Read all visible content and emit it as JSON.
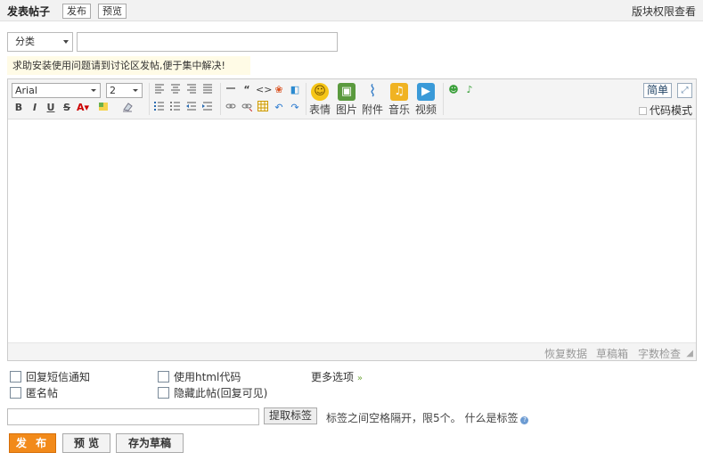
{
  "header": {
    "title": "发表帖子",
    "publish_tab": "发布",
    "preview_tab": "预览",
    "permission_link": "版块权限查看"
  },
  "form": {
    "category_value": "分类",
    "title_value": "",
    "notice": "求助安装使用问题请到讨论区发帖,便于集中解决!"
  },
  "toolbar": {
    "font_family": "Arial",
    "font_size": "2",
    "emotion_label": "表情",
    "image_label": "图片",
    "attach_label": "附件",
    "music_label": "音乐",
    "video_label": "视频",
    "simple_label": "简单",
    "code_mode_label": "代码模式"
  },
  "editor": {
    "content": ""
  },
  "statusbar": {
    "restore": "恢复数据",
    "draft": "草稿箱",
    "word_check": "字数检查"
  },
  "options": {
    "sms_notify": "回复短信通知",
    "html_code": "使用html代码",
    "anonymous": "匿名帖",
    "hide_post": "隐藏此帖(回复可见)",
    "more": "更多选项"
  },
  "tags": {
    "value": "",
    "extract_button": "提取标签",
    "tip": "标签之间空格隔开，限5个。 什么是标签"
  },
  "actions": {
    "publish": "发 布",
    "preview": "预 览",
    "save_draft": "存为草稿"
  },
  "colors": {
    "accent": "#f28a1a",
    "notice_bg": "#fffbe6"
  },
  "icons": [
    "bold-icon",
    "italic-icon",
    "underline-icon",
    "strike-icon",
    "font-color-icon",
    "bg-color-icon",
    "clear-format-icon",
    "align-left-icon",
    "align-center-icon",
    "align-right-icon",
    "justify-icon",
    "ordered-list-icon",
    "unordered-list-icon",
    "outdent-icon",
    "indent-icon",
    "hr-icon",
    "quote-icon",
    "code-icon",
    "link-icon",
    "unlink-icon",
    "table-icon",
    "undo-icon",
    "redo-icon",
    "smiley-icon",
    "image-icon",
    "paperclip-icon",
    "music-note-icon",
    "video-icon",
    "fullscreen-icon",
    "help-icon"
  ]
}
